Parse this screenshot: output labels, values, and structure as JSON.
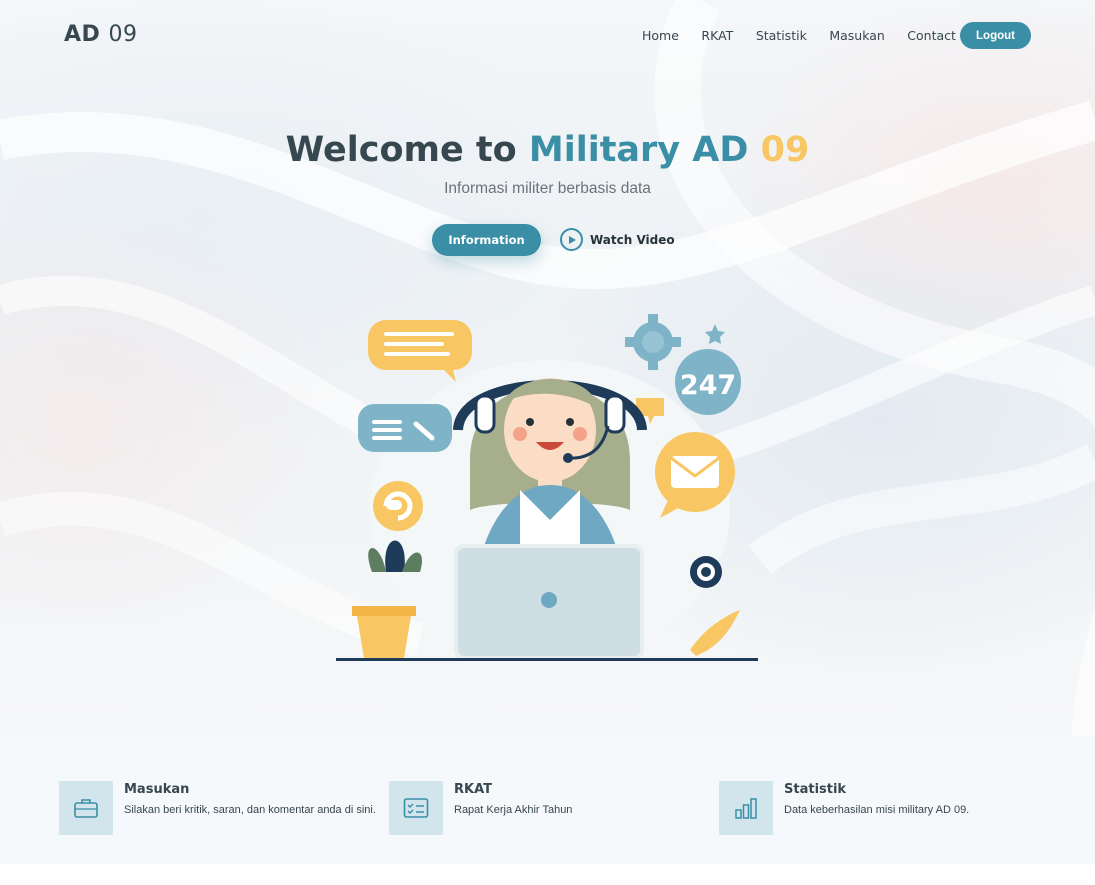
{
  "header": {
    "logo_bold": "AD",
    "logo_light": "09",
    "nav": [
      "Home",
      "RKAT",
      "Statistik",
      "Masukan",
      "Contact"
    ],
    "logout_label": "Logout"
  },
  "hero": {
    "title_part1": "Welcome to",
    "title_part2": "Military AD",
    "title_part3": "09",
    "subtitle": "Informasi militer berbasis data",
    "info_button": "Information",
    "watch_label": "Watch Video",
    "illustration_number": "247"
  },
  "features": [
    {
      "icon": "briefcase-icon",
      "title": "Masukan",
      "desc": "Silakan beri kritik, saran, dan komentar anda di sini."
    },
    {
      "icon": "checklist-icon",
      "title": "RKAT",
      "desc": "Rapat Kerja Akhir Tahun"
    },
    {
      "icon": "bar-chart-icon",
      "title": "Statistik",
      "desc": "Data keberhasilan misi military AD 09."
    }
  ],
  "colors": {
    "primary": "#3a8ea6",
    "accent_yellow": "#f8c763",
    "text": "#37474f"
  }
}
